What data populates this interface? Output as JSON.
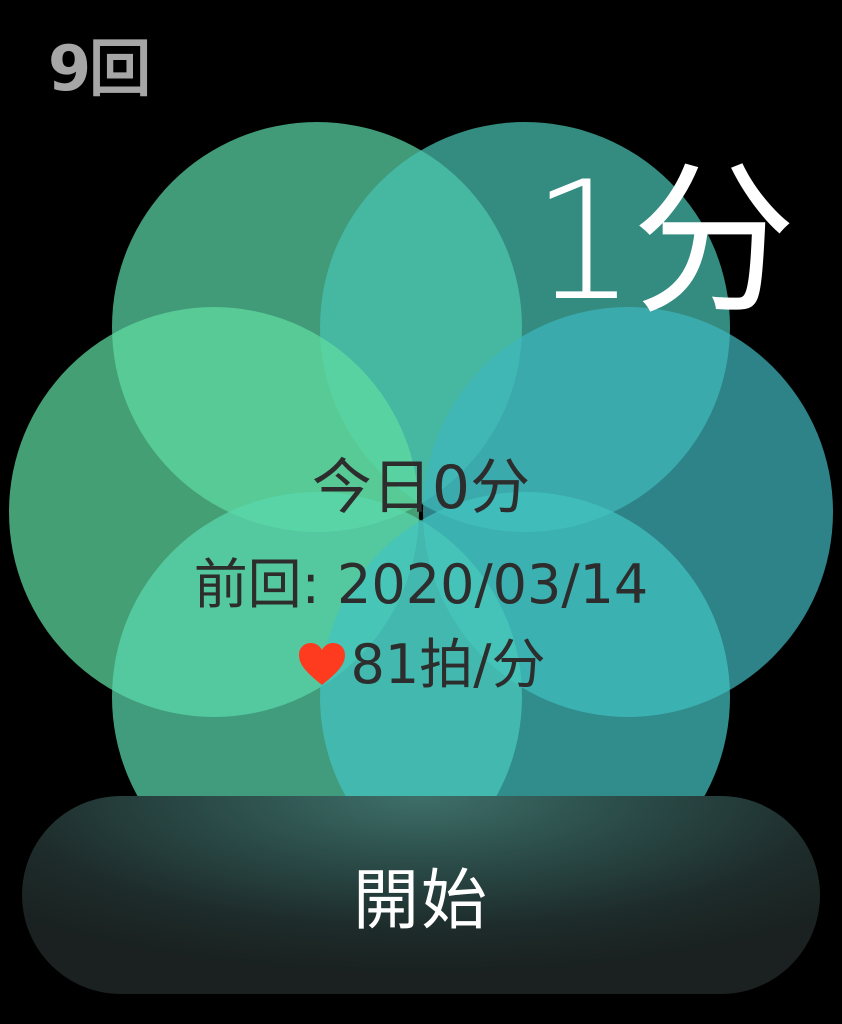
{
  "session": {
    "count": "9回",
    "duration": "1分"
  },
  "stats": {
    "today": "今日0分",
    "last_session": "前回: 2020/03/14",
    "heart_rate": "81拍/分"
  },
  "actions": {
    "start_label": "開始"
  },
  "icons": {
    "heart": "heart-icon"
  },
  "colors": {
    "heart": "#ff3b1f",
    "petal_green": "#5fe0a3",
    "petal_teal": "#4fd6d2",
    "button_bg": "#1d2b2a",
    "count_text": "#a6a6a6"
  }
}
